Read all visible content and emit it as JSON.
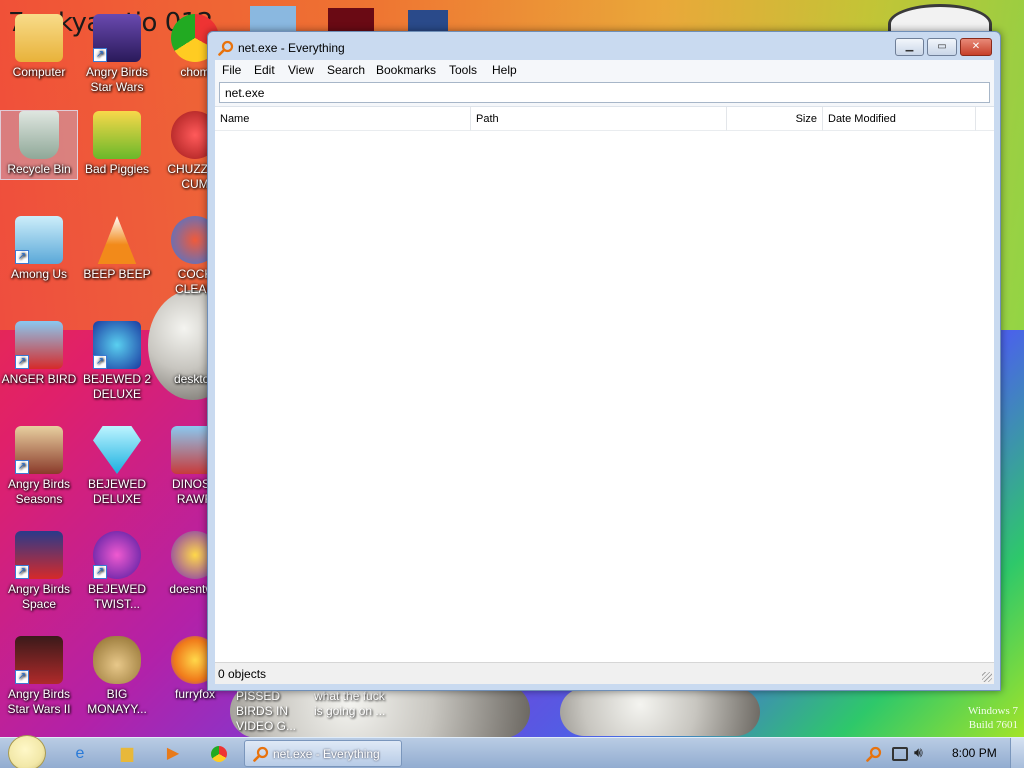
{
  "desktop": {
    "banner_text": "7 sskyae tio 012",
    "icons": [
      {
        "label": "Computer",
        "color": "#f2c65a"
      },
      {
        "label": "Angry Birds Star Wars",
        "color": "#3a2a7a"
      },
      {
        "label": "chom",
        "color": "#ffffff"
      },
      {
        "label": "Recycle Bin",
        "color": "#9fb8a0"
      },
      {
        "label": "Bad Piggies",
        "color": "#8fc83a"
      },
      {
        "label": "CHUZZLE CUM",
        "color": "#e22222"
      },
      {
        "label": "Among Us",
        "color": "#8fd0ea"
      },
      {
        "label": "BEEP BEEP",
        "color": "#f28a1a"
      },
      {
        "label": "COCK CLEAN",
        "color": "#3a78e0"
      },
      {
        "label": "ANGER BIRD",
        "color": "#d62a2a"
      },
      {
        "label": "BEJEWED 2 DELUXE",
        "color": "#2a3aa0"
      },
      {
        "label": "desktop",
        "color": "#dedede"
      },
      {
        "label": "Angry Birds Seasons",
        "color": "#8a3a2a"
      },
      {
        "label": "BEJEWED DELUXE",
        "color": "#2ab8e8"
      },
      {
        "label": "DINOSA RAWR",
        "color": "#c83a3a"
      },
      {
        "label": "Angry Birds Space",
        "color": "#1a2a6a"
      },
      {
        "label": "BEJEWED TWIST...",
        "color": "#6a2ab0"
      },
      {
        "label": "doesntwo",
        "color": "#7a2ab8"
      },
      {
        "label": "Angry Birds Star Wars II",
        "color": "#b02a2a"
      },
      {
        "label": "BIG MONAYY...",
        "color": "#c8a04a"
      },
      {
        "label": "furryfox",
        "color": "#f07a1a"
      }
    ],
    "wall_text_1": "PISSED BIRDS IN VIDEO G...",
    "wall_text_2": "what the fuck is going on ...",
    "watermark_line1": "Windows 7",
    "watermark_line2": "Build 7601"
  },
  "window": {
    "title": "net.exe - Everything",
    "menu": [
      "File",
      "Edit",
      "View",
      "Search",
      "Bookmarks",
      "Tools",
      "Help"
    ],
    "search_value": "net.exe",
    "columns": [
      "Name",
      "Path",
      "Size",
      "Date Modified"
    ],
    "status": "0 objects",
    "accent": "#e8720c"
  },
  "taskbar": {
    "task_label": "net.exe - Everything",
    "clock": "8:00 PM",
    "pinned": [
      "internet-explorer-icon",
      "folder-icon",
      "media-player-icon",
      "chrome-icon"
    ]
  }
}
